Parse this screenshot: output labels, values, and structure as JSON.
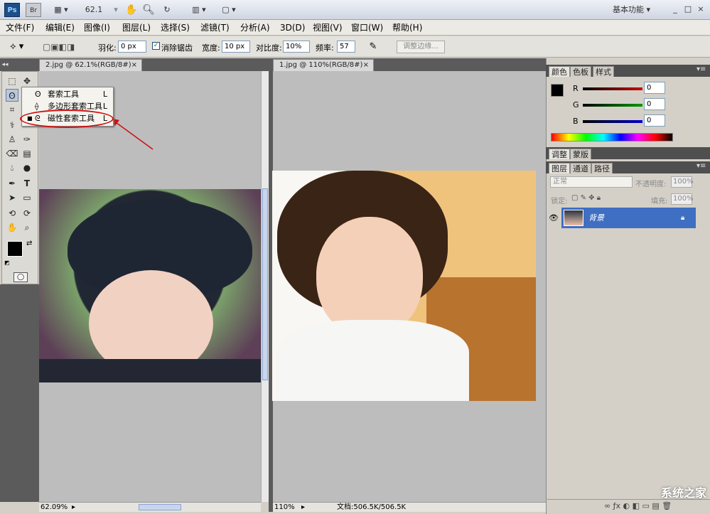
{
  "app": {
    "logo": "Ps",
    "bridge": "Br",
    "zoom": "62.1",
    "workspace": "基本功能",
    "window_controls": [
      "_",
      "□",
      "×"
    ]
  },
  "menu": [
    "文件(F)",
    "编辑(E)",
    "图像(I)",
    "图层(L)",
    "选择(S)",
    "滤镜(T)",
    "分析(A)",
    "3D(D)",
    "视图(V)",
    "窗口(W)",
    "帮助(H)"
  ],
  "options": {
    "feather_label": "羽化:",
    "feather_value": "0 px",
    "antialias_label": "消除锯齿",
    "width_label": "宽度:",
    "width_value": "10 px",
    "contrast_label": "对比度:",
    "contrast_value": "10%",
    "frequency_label": "频率:",
    "frequency_value": "57",
    "refine_edge": "调整边缘..."
  },
  "documents": [
    {
      "tab": "2.jpg @ 62.1%(RGB/8#)",
      "status_zoom": "62.09%"
    },
    {
      "tab": "1.jpg @ 110%(RGB/8#)",
      "status_zoom": "110%",
      "status_doc": "文档:506.5K/506.5K"
    }
  ],
  "flyout": {
    "items": [
      {
        "label": "套索工具",
        "key": "L"
      },
      {
        "label": "多边形套索工具",
        "key": "L"
      },
      {
        "label": "磁性套索工具",
        "key": "L",
        "selected": true
      }
    ]
  },
  "panels": {
    "color_tabs": [
      "颜色",
      "色板",
      "样式"
    ],
    "channels": [
      {
        "label": "R",
        "value": "0",
        "color": "#cc0000"
      },
      {
        "label": "G",
        "value": "0",
        "color": "#009900"
      },
      {
        "label": "B",
        "value": "0",
        "color": "#0000cc"
      }
    ],
    "adjust_tabs": [
      "调整",
      "蒙版"
    ],
    "layer_tabs": [
      "图层",
      "通道",
      "路径"
    ],
    "blend_mode": "正常",
    "opacity_label": "不透明度:",
    "opacity_value": "100%",
    "lock_label": "锁定:",
    "fill_label": "填充:",
    "fill_value": "100%",
    "layer_name": "背景"
  },
  "watermark": "系统之家"
}
